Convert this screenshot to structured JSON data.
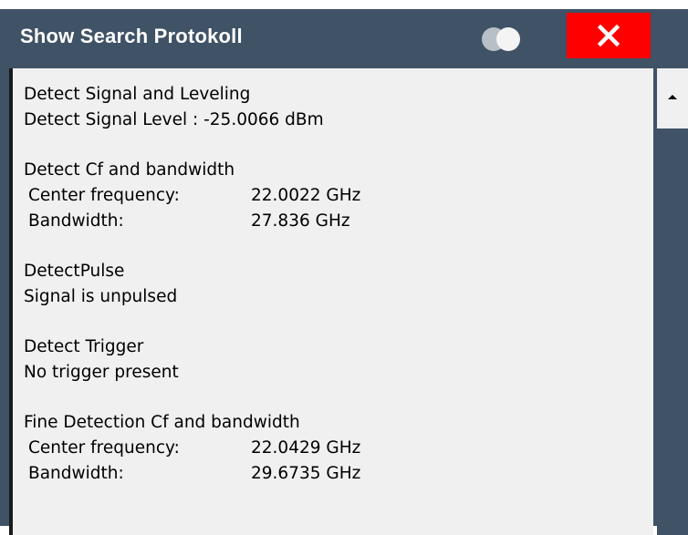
{
  "window": {
    "title": "Show Search Protokoll",
    "toggle_icon": "toggle-icon",
    "close_icon": "close-icon",
    "colors": {
      "title_bar": "#3f5266",
      "close_button": "#ff0000",
      "content_bg": "#f0f0f0"
    }
  },
  "log": {
    "sections": [
      {
        "heading": "Detect Signal and Leveling",
        "line": "Detect Signal Level : -25.0066 dBm"
      },
      {
        "heading": "Detect Cf and bandwidth",
        "rows": [
          {
            "key": "Center frequency:",
            "value": "22.0022 GHz"
          },
          {
            "key": "Bandwidth:",
            "value": "27.836 GHz"
          }
        ]
      },
      {
        "heading": "DetectPulse",
        "line": "Signal is unpulsed"
      },
      {
        "heading": "Detect Trigger",
        "line": "No trigger present"
      },
      {
        "heading": "Fine Detection Cf and bandwidth",
        "rows": [
          {
            "key": "Center frequency:",
            "value": "22.0429 GHz"
          },
          {
            "key": "Bandwidth:",
            "value": "29.6735 GHz"
          }
        ]
      }
    ]
  },
  "scrollbar": {
    "up_icon": "triangle-up-icon"
  }
}
